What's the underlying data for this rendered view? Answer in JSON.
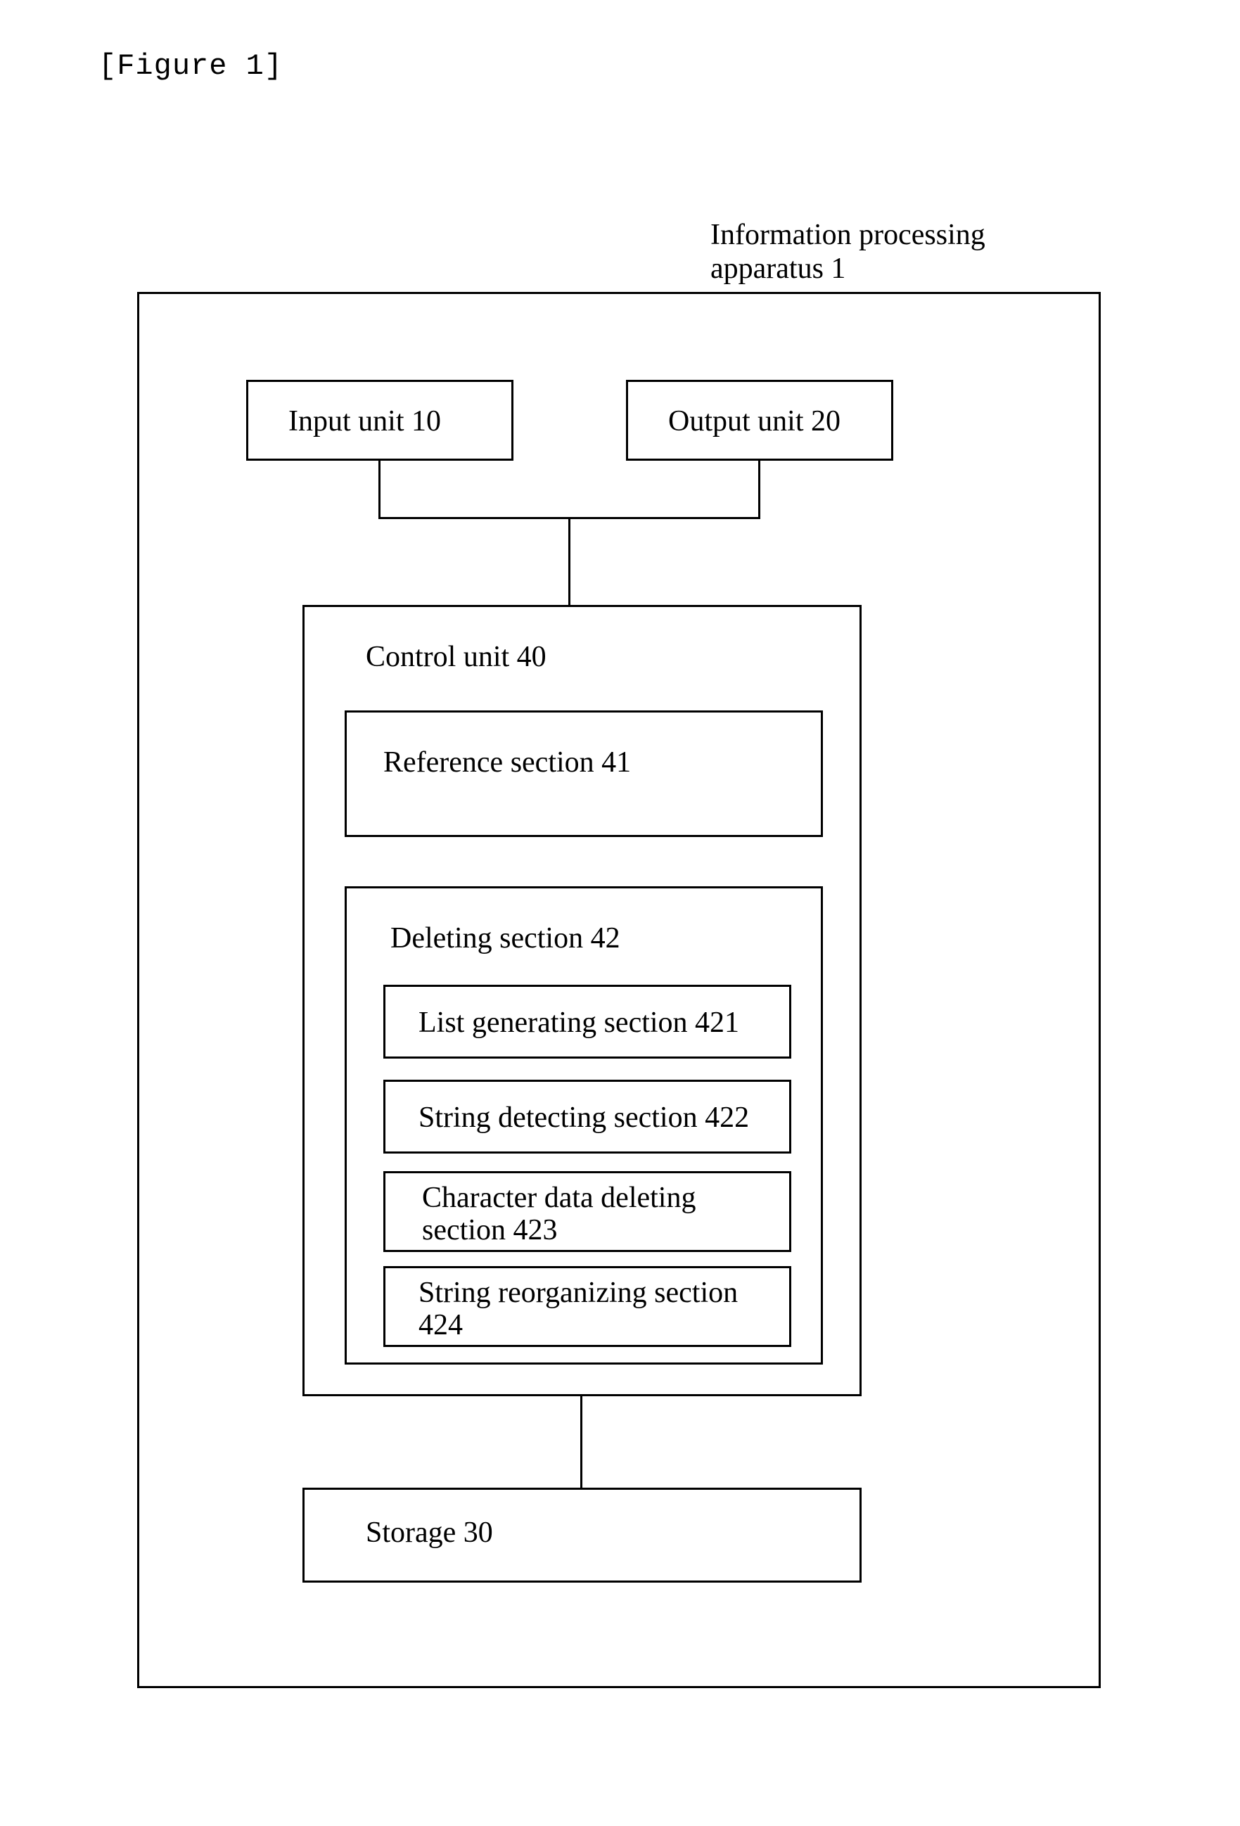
{
  "figure_label": "[Figure 1]",
  "apparatus_label": "Information processing\napparatus 1",
  "boxes": {
    "input_unit": "Input unit 10",
    "output_unit": "Output unit 20",
    "control_unit": "Control unit 40",
    "reference_section": "Reference section 41",
    "deleting_section": "Deleting section 42",
    "list_generating": "List generating section 421",
    "string_detecting": "String detecting section 422",
    "char_data_deleting": "Character data deleting section 423",
    "string_reorganizing": "String reorganizing section 424",
    "storage": "Storage 30"
  }
}
